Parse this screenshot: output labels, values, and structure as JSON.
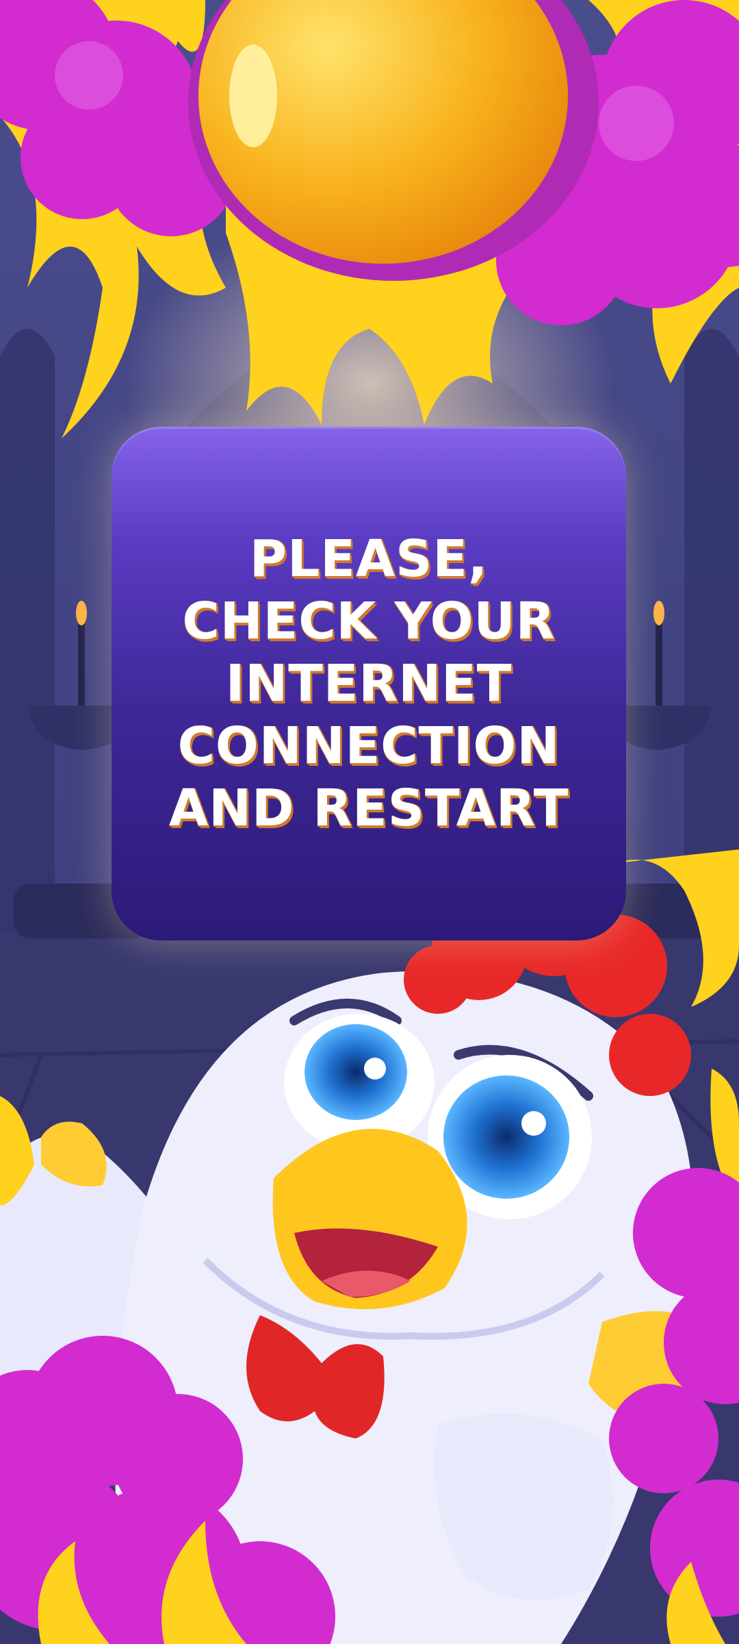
{
  "dialog": {
    "lines": [
      "PLEASE,",
      "CHECK YOUR",
      "INTERNET",
      "CONNECTION",
      "AND RESTART"
    ]
  },
  "colors": {
    "panel_top": "#8563ea",
    "panel_bottom": "#2c1a78",
    "text": "#ffffff",
    "text_outline": "#d07a2a",
    "magenta_cloud": "#d22bd0",
    "flame": "#ffd21e",
    "egg": "#f6a316",
    "background": "#3a3a78"
  },
  "icons": [
    "golden-egg-icon",
    "chicken-mascot-icon",
    "flame-icon",
    "candle-icon",
    "magenta-smoke-icon"
  ]
}
